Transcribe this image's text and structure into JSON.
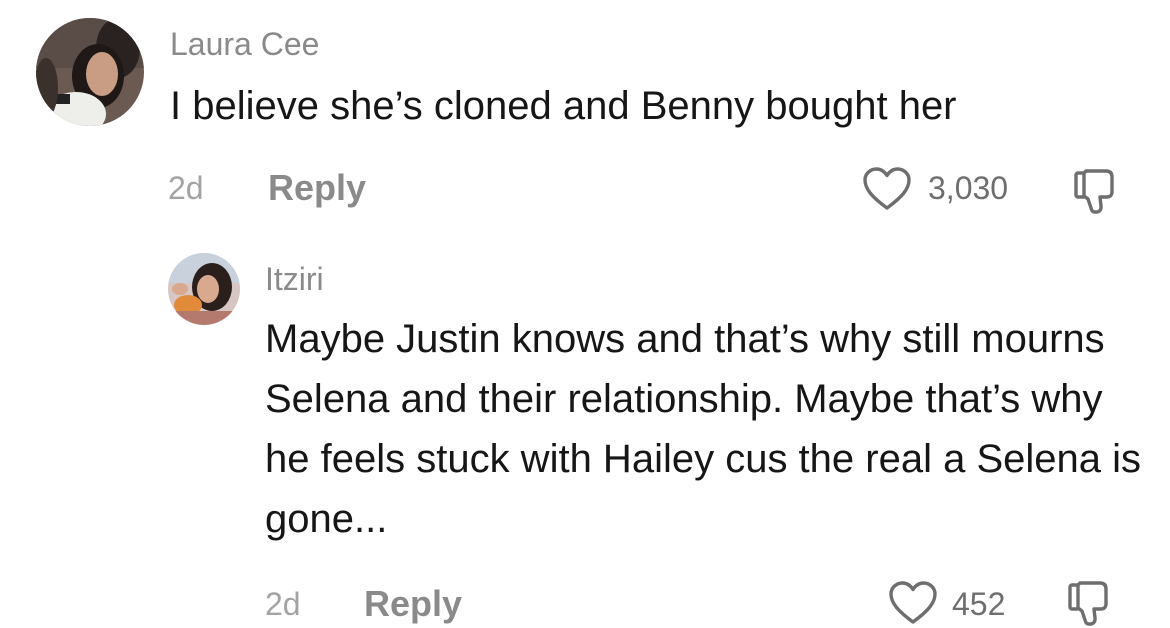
{
  "comments": [
    {
      "username": "Laura Cee",
      "text": "I believe she’s cloned and Benny bought her",
      "time": "2d",
      "reply_label": "Reply",
      "likes": "3,030",
      "avatar_icon": "user-avatar-photo"
    },
    {
      "username": "Itziri",
      "text": "Maybe Justin knows and that’s why still mourns Selena and their relationship. Maybe that’s why he feels stuck with Hailey cus the real a Selena is gone...",
      "time": "2d",
      "reply_label": "Reply",
      "likes": "452",
      "avatar_icon": "user-avatar-photo"
    }
  ],
  "icons": {
    "like": "heart-icon",
    "dislike": "thumbs-down-icon"
  },
  "colors": {
    "text": "#161616",
    "username": "#8a8a8a",
    "meta": "#a3a3a3",
    "icon": "#6e6e6e"
  }
}
